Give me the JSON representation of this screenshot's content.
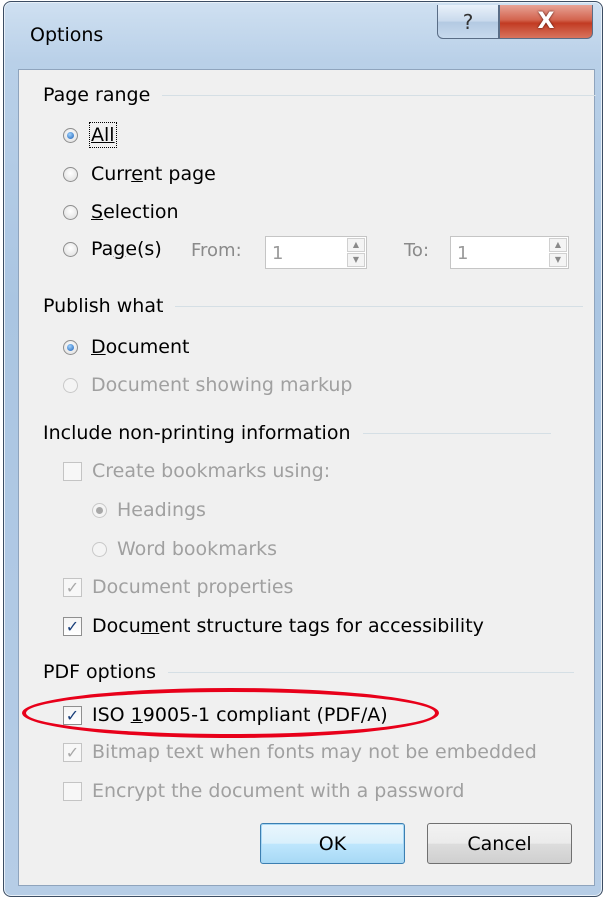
{
  "window": {
    "title": "Options",
    "help_glyph": "?",
    "close_glyph": "X"
  },
  "page_range": {
    "header": "Page range",
    "all": "All",
    "current_page": [
      "Curr",
      "e",
      "nt page"
    ],
    "selection": [
      "",
      "S",
      "election"
    ],
    "pages": [
      "Pa",
      "g",
      "e(s)"
    ],
    "from_label": "From:",
    "from_value": "1",
    "to_label": "To:",
    "to_value": "1"
  },
  "publish_what": {
    "header": "Publish what",
    "document": [
      "",
      "D",
      "ocument"
    ],
    "document_markup": "Document showing markup"
  },
  "non_printing": {
    "header": "Include non-printing information",
    "create_bookmarks": "Create bookmarks using:",
    "headings": "Headings",
    "word_bookmarks": "Word bookmarks",
    "doc_properties": "Document properties",
    "structure_tags": [
      "Docu",
      "m",
      "ent structure tags for accessibility"
    ]
  },
  "pdf_options": {
    "header": "PDF options",
    "iso": [
      "ISO ",
      "1",
      "9005-1 compliant (PDF/A)"
    ],
    "bitmap": "Bitmap text when fonts may not be embedded",
    "encrypt": "Encrypt the document with a password"
  },
  "buttons": {
    "ok": "OK",
    "cancel": "Cancel"
  },
  "checkmark": "✓",
  "colors": {
    "annotation": "#e8001a",
    "close_button": "#c23b22"
  }
}
